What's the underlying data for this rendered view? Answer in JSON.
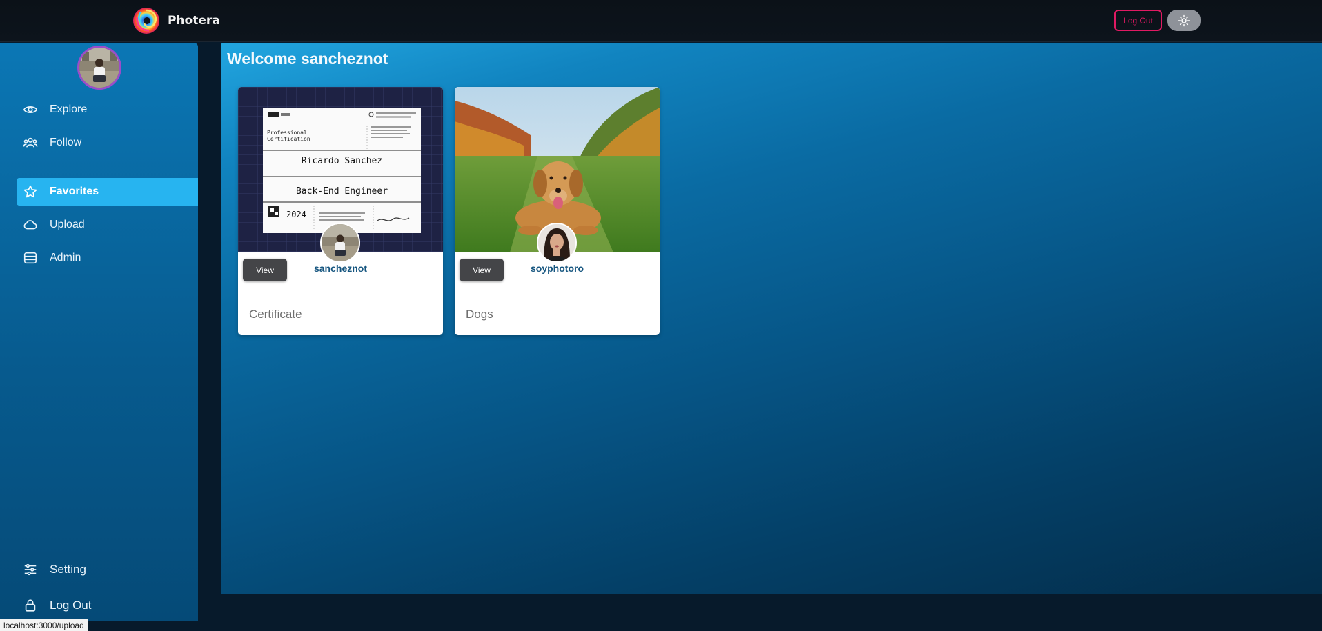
{
  "app": {
    "name": "Photera",
    "logout_label": "Log Out",
    "theme_icon": "sun-icon"
  },
  "sidebar": {
    "avatar": "user-avatar",
    "items": [
      {
        "label": "Explore",
        "icon": "eye-icon",
        "active": false
      },
      {
        "label": "Follow",
        "icon": "users-icon",
        "active": false
      },
      {
        "label": "Favorites",
        "icon": "star-icon",
        "active": true
      },
      {
        "label": "Upload",
        "icon": "cloud-icon",
        "active": false
      },
      {
        "label": "Admin",
        "icon": "database-icon",
        "active": false
      }
    ],
    "bottom": [
      {
        "label": "Setting",
        "icon": "sliders-icon"
      },
      {
        "label": "Log Out",
        "icon": "lock-icon"
      }
    ]
  },
  "main": {
    "welcome": "Welcome sancheznot",
    "cards": [
      {
        "owner": "sancheznot",
        "caption": "Certificate",
        "view_label": "View",
        "image": {
          "kind": "certificate",
          "name": "Ricardo Sanchez",
          "role": "Back-End Engineer",
          "header": "Professional Certification",
          "year": "2024"
        }
      },
      {
        "owner": "soyphotoro",
        "caption": "Dogs",
        "view_label": "View",
        "image": {
          "kind": "dog-photo"
        }
      }
    ]
  },
  "status_url": "localhost:3000/upload",
  "colors": {
    "accent_active": "#27b4f0",
    "logout_border": "#e01a63",
    "owner_name": "#15557f",
    "avatar_ring": "#9b4dca"
  }
}
